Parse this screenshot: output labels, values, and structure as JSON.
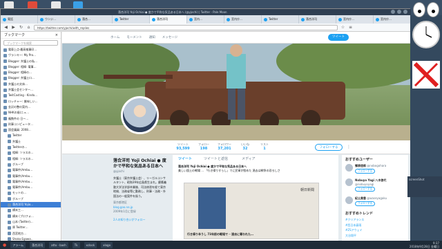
{
  "browser": {
    "window_title": "落合洋司 Yoji Ochiai ● 度かで平和な気品ある日本へ (@yjochi) | Twitter - Pale Moon",
    "tabs": [
      "電話",
      "ウンジ…",
      "落合…",
      "Twitter",
      "落合洋司",
      "宮内…",
      "宮内庁…",
      "Twitter",
      "落合洋司",
      "宮内庁…",
      "宮内庁…"
    ],
    "url": "https://twitter.com/yjochi/with_replies",
    "tweet_button": "ツイート"
  },
  "sidebar": {
    "title": "ブックマーク",
    "search_placeholder": "ブックマークを検索",
    "items": [
      "電車上点·最高検事印…",
      "ヴランキー: My Pro…",
      "Blogger: 弁護士の私…",
      "Blogger: 相棒: 電事…",
      "Blogger: 相棒の…",
      "Blogger: 弁護士ロ…",
      "弁護士の文体…",
      "弁護士会センター…",
      "TwitCasting - Kindo…",
      "ロッチャー: 美味しい…",
      "金沢の整の案内…",
      "NHKの歯(ニュ…",
      "複数件の 日ー…",
      "刑事コンピュータ…",
      "国会議員: 2008…",
      "Twitter",
      "弁護士",
      "Twitterの…",
      "相棒: ソラスの…",
      "相棒: ソラスの…",
      "グループ",
      "電事件(Ambu…",
      "電事件(Ambu…",
      "電事件(Ambu…",
      "電事件(Ambu…",
      "モットの…",
      "グループ",
      "落合洋司 Yojio…",
      "横末工…",
      "横末 (プロフォ…",
      "山本 (Twitter)…",
      "原 Twitter…",
      "西宮地方…",
      "Shoko Egawa…",
      "長野の…",
      "宮内庁…"
    ]
  },
  "twitter_nav": {
    "items": [
      "ホーム",
      "モーメント",
      "通知",
      "メッセージ"
    ],
    "tweet_button": "ツイート"
  },
  "stats": {
    "tweets_label": "ツイート",
    "tweets": "93,599",
    "following_label": "フォロー",
    "following": "198",
    "followers_label": "フォロワー",
    "followers": "37,201",
    "likes_label": "いいね",
    "likes": "32",
    "lists_label": "リスト",
    "lists": "1",
    "follow_button": "フォローする"
  },
  "profile": {
    "name": "落合洋司 Yoji Ochiai ● 度かで平和な気品ある日本へ",
    "handle": "@yjochi",
    "bio": "弁護士（東京弁護士会）、リーガルコンサルタント、昭和39年広島県生まれ。慶應義塾大学法学部卒業後、司法修習を経て東京地検、法務省等に勤務し、刑事・法務・外国法の一般案件を扱う。",
    "location": "東京都港区",
    "website": "blog.goo.ne.jp",
    "joined": "2009年1月に登録",
    "photos": "2人の知り合いがフォロー"
  },
  "timeline": {
    "tab_tweets": "ツイート",
    "tab_replies": "ツイートと返信",
    "tab_media": "メディア",
    "tweet_author": "落合洋司 Yoji Ochiai ● 度かで平和な気品ある日本へ",
    "tweet_text": "美しい国土の戦場 ... 「行き帰りすらし」でに民軍が慰めた 過去は戦争の恐ろしさ",
    "image_caption": "朝日新聞",
    "image_headline": "行き帰り辛うし 73年前の戦場で ─ 過去に奪われた…"
  },
  "right_col": {
    "who_to_follow": "おすすめユーザー",
    "users": [
      {
        "name": "郷原信郎",
        "handle": "@nobogohara",
        "btn": "フォローする"
      },
      {
        "name": "Nobuyo Yagi 八木啓代",
        "handle": "@nobuyoyagi",
        "btn": "フォローする"
      },
      {
        "name": "紀土美香",
        "handle": "@waseyagaku",
        "btn": "フォローする"
      }
    ],
    "trends_title": "おすすめトレンド",
    "trends": [
      "#クリアランス",
      "#西日本豪雨",
      "#ZSアウェイ",
      "大谷翔平"
    ]
  },
  "taskbar": {
    "items": [
      "アラーム",
      "落合洋司",
      "atto - bash",
      "Tk",
      "xclock",
      "xlogo"
    ],
    "time": "9:37",
    "date": "2018年9月28日 金曜日"
  },
  "screenshot_win": {
    "title": "screenShot"
  },
  "colors": {
    "twitter_blue": "#1da1f2",
    "desktop": "#2c3e50"
  }
}
